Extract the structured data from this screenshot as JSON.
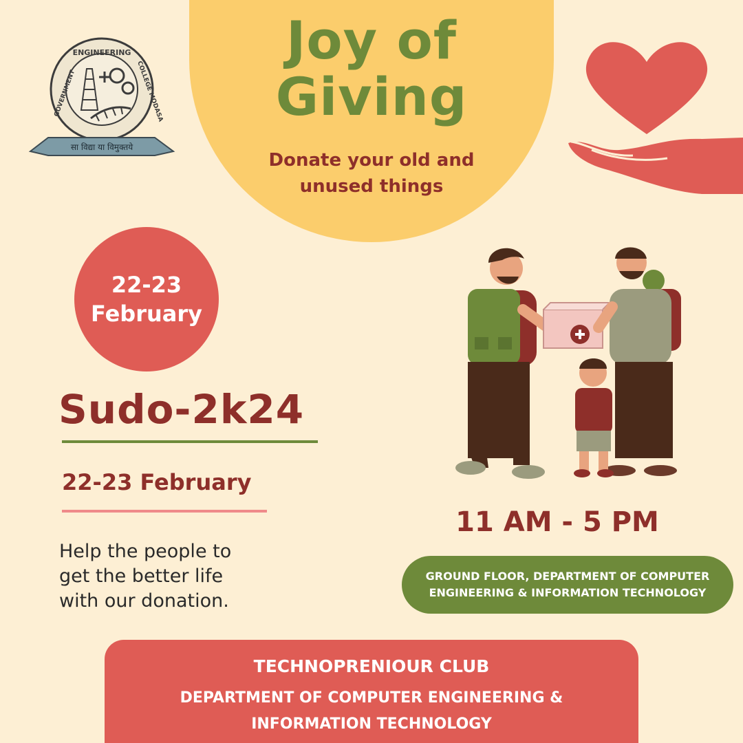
{
  "header": {
    "title_line1": "Joy of",
    "title_line2": "Giving",
    "subtitle_line1": "Donate your old and",
    "subtitle_line2": "unused things"
  },
  "logo": {
    "top_text": "ENGINEERING",
    "left_text": "GOVERNMENT",
    "right_text": "COLLEGE MODASA",
    "motto": "सा विद्या या विमुक्तये"
  },
  "date_badge": {
    "line1": "22-23",
    "line2": "February"
  },
  "event": {
    "name": "Sudo-2k24",
    "date": "22-23 February",
    "description_line1": "Help the people to",
    "description_line2": "get the better life",
    "description_line3": "with our donation."
  },
  "schedule": {
    "time": "11 AM - 5 PM",
    "location_line1": "GROUND FLOOR, DEPARTMENT OF COMPUTER",
    "location_line2": "ENGINEERING & INFORMATION TECHNOLOGY"
  },
  "footer": {
    "club": "TECHNOPRENIOUR CLUB",
    "dept_line1": "DEPARTMENT OF COMPUTER ENGINEERING &",
    "dept_line2": "INFORMATION TECHNOLOGY"
  },
  "colors": {
    "background": "#fdefd4",
    "yellow": "#fbcd6c",
    "green": "#6e8a3a",
    "maroon": "#8e2f2a",
    "coral": "#df5c55",
    "pink_line": "#ef8a8a"
  },
  "icons": {
    "logo": "college-emblem-icon",
    "heart_hand": "heart-in-hand-icon",
    "illustration": "people-donating-box-illustration"
  }
}
